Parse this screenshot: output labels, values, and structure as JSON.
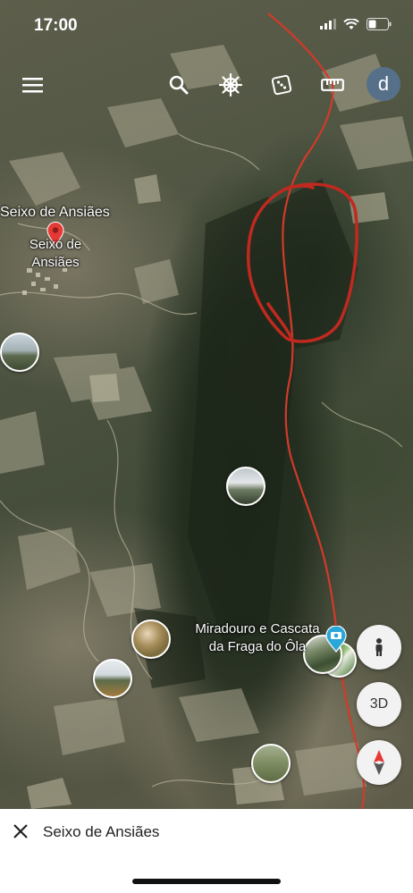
{
  "status_bar": {
    "time": "17:00"
  },
  "toolbar": {
    "menu_icon": "hamburger-menu-icon",
    "search_icon": "search-icon",
    "voyager_icon": "ship-wheel-icon",
    "feeling_lucky_icon": "dice-icon",
    "measure_icon": "ruler-icon",
    "avatar_letter": "d"
  },
  "map": {
    "place_title": "Seixo de Ansiães",
    "pin_label_line1": "Seixo de",
    "pin_label_line2": "Ansiães",
    "poi_line1": "Miradouro e Cascata",
    "poi_line2": "da Fraga do Ôla",
    "pin_color": "#e53935",
    "route_color": "#d23a2a",
    "annotation_color": "#c0291f",
    "poi_pin_color": "#29a7d8"
  },
  "controls": {
    "pegman_icon": "pegman-icon",
    "three_d_label": "3D",
    "compass_icon": "compass-icon"
  },
  "bottom_bar": {
    "close_icon": "close-icon",
    "title": "Seixo de Ansiães"
  }
}
